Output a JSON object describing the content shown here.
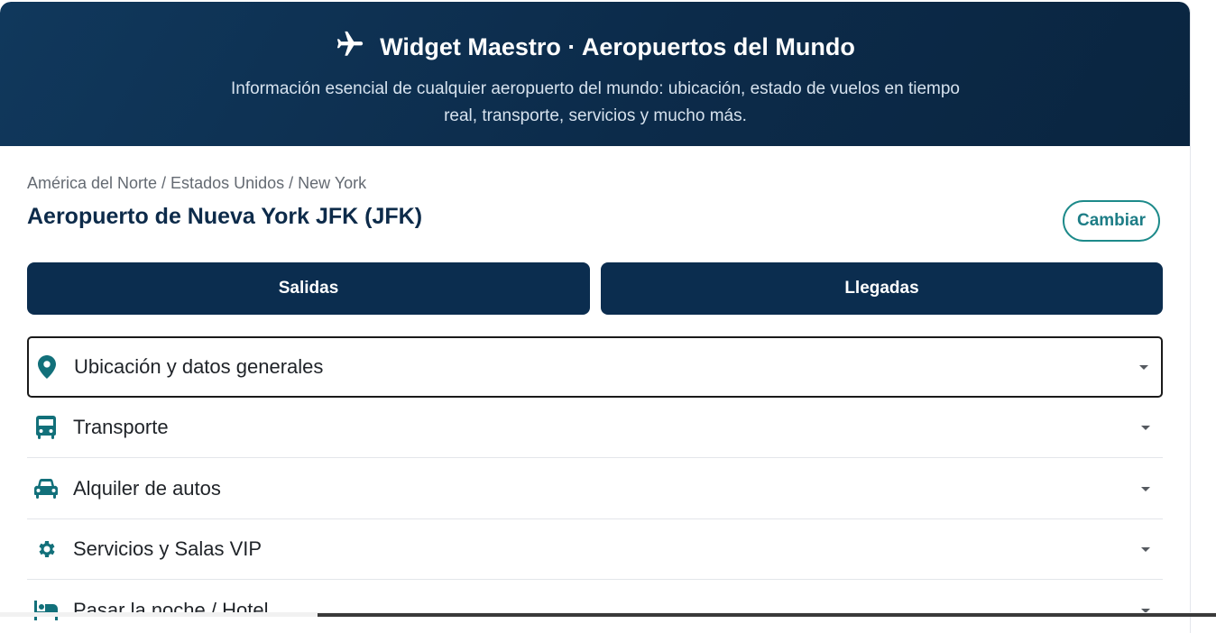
{
  "header": {
    "title": "Widget Maestro · Aeropuertos del Mundo",
    "subtitle": "Información esencial de cualquier aeropuerto del mundo: ubicación, estado de vuelos en tiempo real, transporte, servicios y mucho más.",
    "icon": "airplane-icon"
  },
  "airport": {
    "breadcrumb": "América del Norte / Estados Unidos / New York",
    "name": "Aeropuerto de Nueva York JFK (JFK)",
    "change_label": "Cambiar"
  },
  "flights": {
    "departures_label": "Salidas",
    "arrivals_label": "Llegadas"
  },
  "sections": [
    {
      "label": "Ubicación y datos generales",
      "icon": "location-pin-icon",
      "active": true
    },
    {
      "label": "Transporte",
      "icon": "bus-icon",
      "active": false
    },
    {
      "label": "Alquiler de autos",
      "icon": "car-icon",
      "active": false
    },
    {
      "label": "Servicios y Salas VIP",
      "icon": "gear-icon",
      "active": false
    },
    {
      "label": "Pasar la noche / Hotel",
      "icon": "bed-icon",
      "active": false
    }
  ],
  "colors": {
    "header_bg": "#0c2b4a",
    "button_bg": "#0b2d4f",
    "accent_teal": "#1d7d86",
    "icon_teal": "#12707a"
  }
}
